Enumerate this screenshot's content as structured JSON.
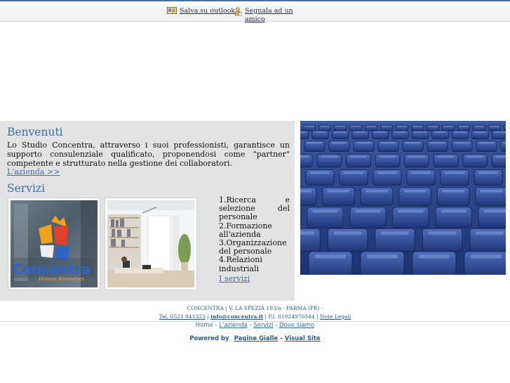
{
  "toolbar": {
    "save_label": "Salva su outlook",
    "share_label": "Segnala ad un amico"
  },
  "welcome": {
    "title": "Benvenuti",
    "text": "Lo Studio Concentra, attraverso i suoi professionisti, garantisce un supporto consulenziale qualificato, proponendosi come \"partner\" competente e strutturato nella gestione dei collaboratori.",
    "link": "L'azienda >>"
  },
  "services": {
    "title": "Servizi",
    "logo_text": "Concentra",
    "logo_subtext": "Human Resources",
    "items": [
      "1.Ricerca e selezione del personale",
      "2.Formazione all'azienda",
      "3.Organizzazione del personale",
      "4.Relazioni industriali"
    ],
    "link": "I servizi"
  },
  "footer": {
    "address": "CONCENTRA | V. LA SPEZIA 193/a - PARMA (PR) -",
    "phone": "Tel. 0521 941323",
    "email": "info@concentra.it",
    "vat": "P.I. 01924970344",
    "legal": "Note Legali",
    "nav": [
      "Home",
      "L'azienda",
      "Servizi",
      "Dove siamo"
    ],
    "powered_by": "Powered by",
    "provider_1": "Pagine Gialle",
    "provider_2": "Visual Site"
  },
  "colors": {
    "accent": "#3b6fa7",
    "panel": "#e3e3e3",
    "seat_blue": "#2a3f7a"
  }
}
